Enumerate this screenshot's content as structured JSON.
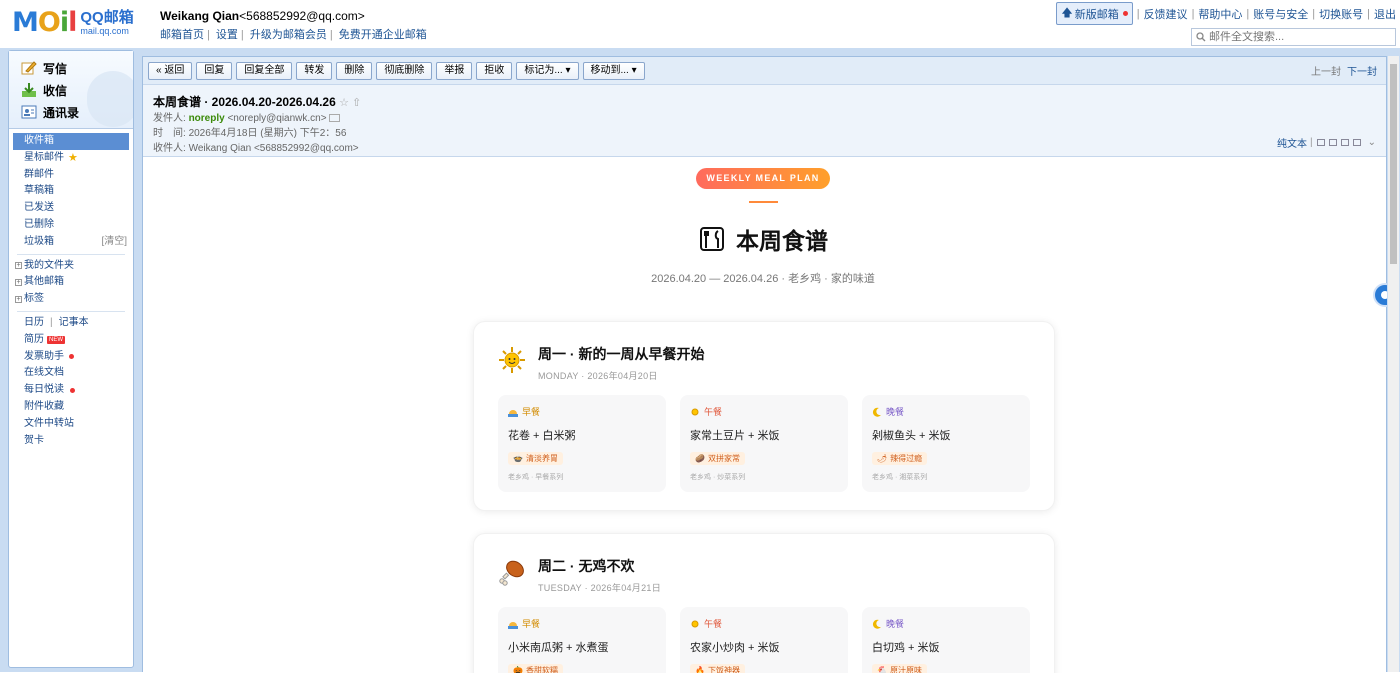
{
  "app": {
    "logo_mail": "MOIL",
    "logo_qq": "QQ邮箱",
    "logo_url": "mail.qq.com"
  },
  "user": {
    "name": "Weikang Qian",
    "email": "<568852992@qq.com>",
    "links": [
      "邮箱首页",
      "设置",
      "升级为邮箱会员",
      "免费开通企业邮箱"
    ]
  },
  "top_links": {
    "new_version": "新版邮箱",
    "items": [
      "反馈建议",
      "帮助中心",
      "账号与安全",
      "切换账号",
      "退出"
    ]
  },
  "search": {
    "placeholder": "邮件全文搜索..."
  },
  "left": {
    "actions": [
      "写信",
      "收信",
      "通讯录"
    ],
    "folders": [
      {
        "label": "收件箱",
        "active": true
      },
      {
        "label": "星标邮件"
      },
      {
        "label": "群邮件"
      },
      {
        "label": "草稿箱"
      },
      {
        "label": "已发送"
      },
      {
        "label": "已删除"
      },
      {
        "label": "垃圾箱",
        "extra": "[清空]"
      }
    ],
    "groups": [
      "我的文件夹",
      "其他邮箱",
      "标签"
    ],
    "calendar": "日历",
    "notebook": "记事本",
    "tools": [
      "简历",
      "发票助手",
      "在线文档",
      "每日悦读",
      "附件收藏",
      "文件中转站",
      "贺卡"
    ],
    "new_badge": "NEW"
  },
  "toolbar": {
    "back": "« 返回",
    "buttons": [
      "回复",
      "回复全部",
      "转发",
      "删除",
      "彻底删除",
      "举报",
      "拒收"
    ],
    "mark": "标记为...",
    "move": "移动到...",
    "prev": "上一封",
    "next": "下一封"
  },
  "mail": {
    "subject": "本周食谱 · 2026.04.20-2026.04.26",
    "from_label": "发件人:",
    "from_name": "noreply",
    "from_addr": "<noreply@qianwk.cn>",
    "time_label": "时　间:",
    "time": "2026年4月18日 (星期六) 下午2：56",
    "to_label": "收件人:",
    "to": "Weikang Qian <568852992@qq.com>",
    "plain_text": "纯文本"
  },
  "body": {
    "pill": "WEEKLY MEAL PLAN",
    "title": "本周食谱",
    "subline": "2026.04.20 — 2026.04.26 · 老乡鸡 · 家的味道",
    "days": [
      {
        "title": "周一 · 新的一周从早餐开始",
        "sub": "MONDAY · 2026年04月20日",
        "meals": [
          {
            "label": "早餐",
            "dish": "花卷 + 白米粥",
            "tag": "清淡养胃",
            "note": "老乡鸡 · 早餐系列"
          },
          {
            "label": "午餐",
            "dish": "家常土豆片 + 米饭",
            "tag": "双拼家常",
            "note": "老乡鸡 · 炒菜系列"
          },
          {
            "label": "晚餐",
            "dish": "剁椒鱼头 + 米饭",
            "tag": "辣得过瘾",
            "note": "老乡鸡 · 湘菜系列"
          }
        ]
      },
      {
        "title": "周二 · 无鸡不欢",
        "sub": "TUESDAY · 2026年04月21日",
        "meals": [
          {
            "label": "早餐",
            "dish": "小米南瓜粥 + 水煮蛋",
            "tag": "香甜软糯"
          },
          {
            "label": "午餐",
            "dish": "农家小炒肉 + 米饭",
            "tag": "下饭神器"
          },
          {
            "label": "晚餐",
            "dish": "白切鸡 + 米饭",
            "tag": "原汁原味"
          }
        ]
      }
    ]
  }
}
